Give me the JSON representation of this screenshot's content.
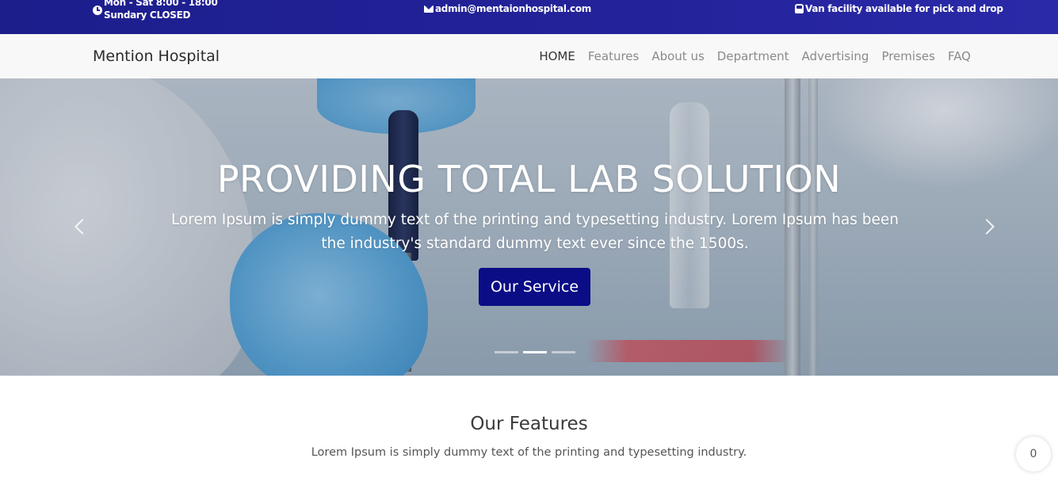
{
  "topbar": {
    "hours_line1": "Mon - Sat 8:00 - 18:00",
    "hours_line2": "Sundary CLOSED",
    "email": "admin@mentaionhospital.com",
    "van": "Van facility available for pick and drop",
    "icons": [
      "clock-icon",
      "envelope-icon",
      "bus-icon"
    ]
  },
  "navbar": {
    "brand": "Mention Hospital",
    "links": [
      "HOME",
      "Features",
      "About us",
      "Department",
      "Advertising",
      "Premises",
      "FAQ"
    ],
    "active": "HOME"
  },
  "hero": {
    "title": "PROVIDING TOTAL LAB SOLUTION",
    "text": "Lorem Ipsum is simply dummy text of the printing and typesetting industry. Lorem Ipsum has been the industry's standard dummy text ever since the 1500s.",
    "button": "Our Service",
    "slides": 3,
    "active_slide": 2
  },
  "features": {
    "title": "Our Features",
    "subtitle": "Lorem Ipsum is simply dummy text of the printing and typesetting industry."
  },
  "counter": {
    "value": "0"
  },
  "colors": {
    "topbar": "#24229a",
    "button": "#0a0d85",
    "nav_bg": "#f8f8f8"
  }
}
